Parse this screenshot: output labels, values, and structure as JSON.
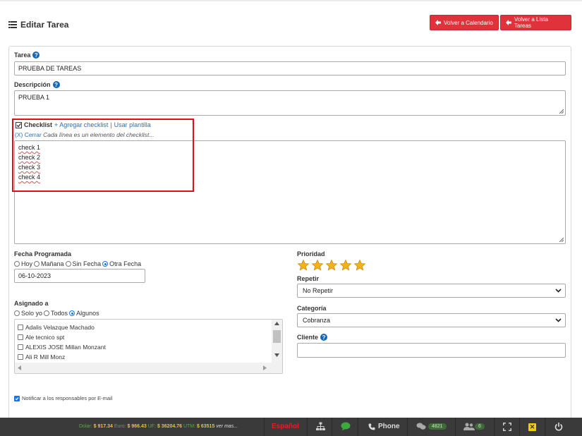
{
  "header": {
    "title": "Editar Tarea",
    "btn_calendar": "Volver a Calendario",
    "btn_list": "Volver a Lista Tareas"
  },
  "form": {
    "tarea_label": "Tarea",
    "tarea_value": "PRUEBA DE TAREAS",
    "descripcion_label": "Descripción",
    "descripcion_value": "PRUEBA 1",
    "checklist_label": "Checklist",
    "add_checklist": "+ Agregar checklist",
    "separator": "|",
    "use_template": "Usar plantilla",
    "close_link": "(X) Cerrar",
    "checklist_hint": "Cada línea es un elemento del checklist...",
    "checklist_items": [
      "check 1",
      "check 2",
      "check 3",
      "check 4"
    ],
    "fecha_label": "Fecha Programada",
    "fecha_options": [
      "Hoy",
      "Mañana",
      "Sin Fecha",
      "Otra Fecha"
    ],
    "fecha_selected": "Otra Fecha",
    "fecha_value": "06-10-2023",
    "prioridad_label": "Prioridad",
    "prioridad_stars": 5,
    "repetir_label": "Repetir",
    "repetir_value": "No Repetir",
    "categoria_label": "Categoría",
    "categoria_value": "Cobranza",
    "cliente_label": "Cliente",
    "cliente_value": "",
    "asignado_label": "Asignado a",
    "asignado_options": [
      "Solo yo",
      "Todos",
      "Algunos"
    ],
    "asignado_selected": "Algunos",
    "asignado_users": [
      "Adalis Velazque Machado",
      "Ale tecnico spt",
      "ALEXIS JOSE Millan Monzant",
      "Ali R Mill Monz"
    ],
    "notify_label": "Notificar a los responsables por E-mail"
  },
  "footer": {
    "dolar_label": "Dolar:",
    "dolar_value": "$ 917.34",
    "euro_label": "Euro:",
    "euro_value": "$ 966.43",
    "uf_label": "UF:",
    "uf_value": "$ 36204.76",
    "utm_label": "UTM:",
    "utm_value": "$ 63515",
    "more": "ver mas...",
    "language": "Español",
    "phone": "Phone",
    "chat_count": "4821",
    "users_count": "6"
  },
  "colors": {
    "accent_red": "#e0323a",
    "link_blue": "#2a6fb8",
    "highlight_red": "#e01010",
    "footer_bg": "#3a3a3a"
  }
}
